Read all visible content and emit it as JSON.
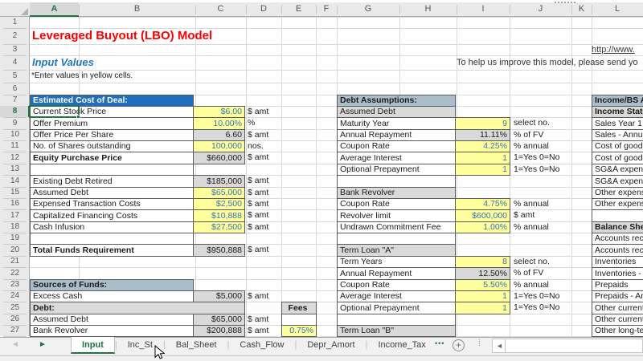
{
  "colors": {
    "accent_green": "#217346",
    "deal_header_blue": "#1F6FBE",
    "deal_header_text": "#FFFFFF",
    "section_header_bluegray": "#A9BDCB",
    "subheader_gray": "#D9D9D9",
    "input_yellow": "#FFFF9E",
    "input_text_blue": "#2E75B6",
    "calc_gray": "#D9D9D9",
    "title_red": "#FF0000",
    "subtitle_blue": "#1F7AC4",
    "cell_border": "#595959",
    "grid_line": "#D9D9D9",
    "header_strip_bg": "#E9E9E9",
    "selected_header_bg": "#D8D8D8"
  },
  "sheet": {
    "column_letters": [
      "A",
      "B",
      "C",
      "D",
      "E",
      "F",
      "G",
      "H",
      "I",
      "J",
      "K",
      "L"
    ],
    "row_numbers": [
      "1",
      "2",
      "3",
      "4",
      "5",
      "6",
      "7",
      "8",
      "9",
      "10",
      "11",
      "12",
      "13",
      "14",
      "15",
      "16",
      "17",
      "18",
      "19",
      "20",
      "21",
      "22",
      "23",
      "24",
      "25",
      "26",
      "27"
    ],
    "selected_cell": "A8",
    "selected_column": "A",
    "selected_row": "8"
  },
  "header_texts": {
    "title": "Leveraged Buyout (LBO) Model",
    "subtitle": "Input Values",
    "note": "*Enter values in yellow cells.",
    "hyperlink": "http://www.",
    "feedback": "To help us improve this model, please send yo"
  },
  "deal_table": {
    "header": "Estimated Cost of Deal:",
    "rows": [
      {
        "row": 8,
        "label": "Current Stock Price",
        "value": "$6.00",
        "unit": "$ amt",
        "kind": "input",
        "selected": true
      },
      {
        "row": 9,
        "label": "Offer Premium",
        "value": "10.00%",
        "unit": "%",
        "kind": "input"
      },
      {
        "row": 10,
        "label": "Offer Price Per Share",
        "value": "6.60",
        "unit": "$ amt",
        "kind": "calc"
      },
      {
        "row": 11,
        "label": "No. of Shares outstanding",
        "value": "100,000",
        "unit": "nos.",
        "kind": "input"
      },
      {
        "row": 12,
        "label": "Equity Purchase Price",
        "value": "$660,000",
        "unit": "$ amt",
        "kind": "calc",
        "bold": true
      },
      {
        "row": 13,
        "label": "",
        "kind": "blank"
      },
      {
        "row": 14,
        "label": "Existing Debt Retired",
        "value": "$185,000",
        "unit": "$ amt",
        "kind": "calc"
      },
      {
        "row": 15,
        "label": "Assumed Debt",
        "value": "$65,000",
        "unit": "$ amt",
        "kind": "input"
      },
      {
        "row": 16,
        "label": "Expensed Transaction Costs",
        "value": "$2,500",
        "unit": "$ amt",
        "kind": "input"
      },
      {
        "row": 17,
        "label": "Capitalized Financing Costs",
        "value": "$10,888",
        "unit": "$ amt",
        "kind": "input"
      },
      {
        "row": 18,
        "label": "Cash Infusion",
        "value": "$27,500",
        "unit": "$ amt",
        "kind": "input"
      },
      {
        "row": 19,
        "label": "",
        "kind": "blank"
      },
      {
        "row": 20,
        "label": "Total Funds Requirement",
        "value": "$950,888",
        "unit": "$ amt",
        "kind": "calc",
        "bold": true
      }
    ]
  },
  "sources_table": {
    "header": "Sources of Funds:",
    "fees_header": "Fees",
    "rows": [
      {
        "row": 24,
        "label": "Excess Cash",
        "value": "$5,000",
        "unit": "$ amt",
        "kind": "calc"
      },
      {
        "row": 25,
        "label": "Debt:",
        "kind": "subheader_wide",
        "bold": true
      },
      {
        "row": 26,
        "label": "Assumed Debt",
        "value": "$65,000",
        "unit": "$ amt",
        "kind": "calc",
        "fee": "",
        "fee_kind": "blank"
      },
      {
        "row": 27,
        "label": "Bank Revolver",
        "value": "$200,888",
        "unit": "$ amt",
        "kind": "calc",
        "fee": "0.75%",
        "fee_kind": "input"
      }
    ]
  },
  "debt_table": {
    "header": "Debt Assumptions:",
    "rows": [
      {
        "row": 8,
        "label": "Assumed Debt",
        "kind": "subheader"
      },
      {
        "row": 9,
        "label": "Maturity Year",
        "value": "9",
        "unit": "select no.",
        "kind": "input"
      },
      {
        "row": 10,
        "label": "Annual Repayment",
        "value": "11.11%",
        "unit": "% of FV",
        "kind": "calc"
      },
      {
        "row": 11,
        "label": "Coupon Rate",
        "value": "4.25%",
        "unit": "% annual",
        "kind": "input"
      },
      {
        "row": 12,
        "label": "Average Interest",
        "value": "1",
        "unit": "1=Yes 0=No",
        "kind": "input"
      },
      {
        "row": 13,
        "label": "Optional Prepayment",
        "value": "1",
        "unit": "1=Yes 0=No",
        "kind": "input"
      },
      {
        "row": 14,
        "label": "",
        "kind": "blank"
      },
      {
        "row": 15,
        "label": "Bank Revolver",
        "kind": "subheader"
      },
      {
        "row": 16,
        "label": "Coupon Rate",
        "value": "4.75%",
        "unit": "% annual",
        "kind": "input"
      },
      {
        "row": 17,
        "label": "Revolver limit",
        "value": "$600,000",
        "unit": "$ amt",
        "kind": "input"
      },
      {
        "row": 18,
        "label": "Undrawn Commitment Fee",
        "value": "1.00%",
        "unit": "% annual",
        "kind": "input"
      },
      {
        "row": 19,
        "label": "",
        "kind": "blank"
      },
      {
        "row": 20,
        "label": "Term Loan \"A\"",
        "kind": "subheader"
      },
      {
        "row": 21,
        "label": "Term Years",
        "value": "8",
        "unit": "select no.",
        "kind": "input"
      },
      {
        "row": 22,
        "label": "Annual Repayment",
        "value": "12.50%",
        "unit": "% of FV",
        "kind": "calc"
      },
      {
        "row": 23,
        "label": "Coupon Rate",
        "value": "5.50%",
        "unit": "% annual",
        "kind": "input"
      },
      {
        "row": 24,
        "label": "Average Interest",
        "value": "1",
        "unit": "1=Yes 0=No",
        "kind": "input"
      },
      {
        "row": 25,
        "label": "Optional Prepayment",
        "value": "1",
        "unit": "1=Yes 0=No",
        "kind": "input"
      },
      {
        "row": 26,
        "label": "",
        "kind": "blank"
      },
      {
        "row": 27,
        "label": "Term Loan \"B\"",
        "kind": "subheader"
      }
    ]
  },
  "income_bs_table": {
    "rows": [
      {
        "row": 7,
        "label": "Income/BS A",
        "kind": "header"
      },
      {
        "row": 8,
        "label": "Income State",
        "kind": "subheader"
      },
      {
        "row": 9,
        "label": "Sales Year 1",
        "kind": "plain"
      },
      {
        "row": 10,
        "label": "Sales - Annua",
        "kind": "plain"
      },
      {
        "row": 11,
        "label": "Cost of good",
        "kind": "plain"
      },
      {
        "row": 12,
        "label": "Cost of good",
        "kind": "plain"
      },
      {
        "row": 13,
        "label": "SG&A expens",
        "kind": "plain"
      },
      {
        "row": 14,
        "label": "SG&A expens",
        "kind": "plain"
      },
      {
        "row": 15,
        "label": "Other expens",
        "kind": "plain"
      },
      {
        "row": 16,
        "label": "Other expens",
        "kind": "plain"
      },
      {
        "row": 17,
        "label": "",
        "kind": "blank"
      },
      {
        "row": 18,
        "label": "Balance Shee",
        "kind": "subheader"
      },
      {
        "row": 19,
        "label": "Accounts rec",
        "kind": "plain"
      },
      {
        "row": 20,
        "label": "Accounts rec",
        "kind": "plain"
      },
      {
        "row": 21,
        "label": "Inventories",
        "kind": "plain"
      },
      {
        "row": 22,
        "label": "Inventories -",
        "kind": "plain"
      },
      {
        "row": 23,
        "label": "Prepaids",
        "kind": "plain"
      },
      {
        "row": 24,
        "label": "Prepaids - An",
        "kind": "plain"
      },
      {
        "row": 25,
        "label": "Other current",
        "kind": "plain"
      },
      {
        "row": 26,
        "label": "Other current",
        "kind": "plain"
      },
      {
        "row": 27,
        "label": "Other long-te",
        "kind": "plain"
      }
    ]
  },
  "tab_bar": {
    "nav_prev": "◄",
    "nav_next": "►",
    "tabs": [
      {
        "label": "Input",
        "active": true
      },
      {
        "label": "Inc_St",
        "active": false
      },
      {
        "label": "Bal_Sheet",
        "active": false
      },
      {
        "label": "Cash_Flow",
        "active": false
      },
      {
        "label": "Depr_Amort",
        "active": false
      },
      {
        "label": "Income_Tax",
        "active": false
      }
    ],
    "more": "•••",
    "add": "+",
    "scroll_left": "◄"
  }
}
